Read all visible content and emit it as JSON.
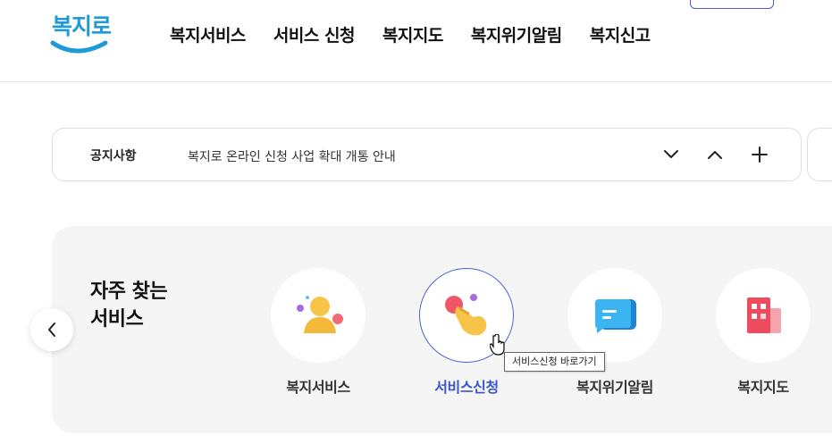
{
  "logo": {
    "text": "복지로"
  },
  "nav": {
    "items": [
      "복지서비스",
      "서비스 신청",
      "복지지도",
      "복지위기알림",
      "복지신고"
    ]
  },
  "notice": {
    "label": "공지사항",
    "text": "복지로 온라인 신청 사업 확대 개통 안내"
  },
  "favorites": {
    "title_line1": "자주 찾는",
    "title_line2": "서비스",
    "items": [
      {
        "label": "복지서비스",
        "icon": "person-icon"
      },
      {
        "label": "서비스신청",
        "icon": "hand-pointer-icon"
      },
      {
        "label": "복지위기알림",
        "icon": "chat-bubble-icon"
      },
      {
        "label": "복지지도",
        "icon": "building-map-icon"
      }
    ],
    "active_index": 1
  },
  "tooltip": {
    "text": "서비스신청 바로가기"
  },
  "colors": {
    "brand": "#1e9ad6",
    "accent": "#3a54c9",
    "panel_bg": "#f5f5f5"
  }
}
